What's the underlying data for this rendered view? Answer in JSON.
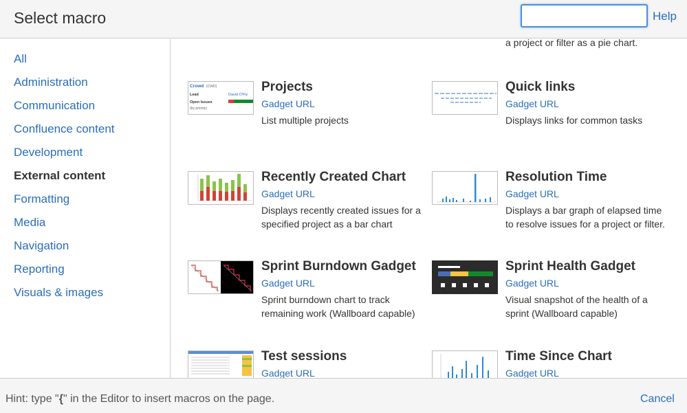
{
  "header": {
    "title": "Select macro",
    "search_value": "",
    "help_label": "Help"
  },
  "sidebar": {
    "categories": [
      {
        "label": "All"
      },
      {
        "label": "Administration"
      },
      {
        "label": "Communication"
      },
      {
        "label": "Confluence content"
      },
      {
        "label": "Development"
      },
      {
        "label": "External content",
        "active": true
      },
      {
        "label": "Formatting"
      },
      {
        "label": "Media"
      },
      {
        "label": "Navigation"
      },
      {
        "label": "Reporting"
      },
      {
        "label": "Visuals & images"
      }
    ]
  },
  "main": {
    "partial_desc": "a project or filter as a pie chart.",
    "macros": [
      {
        "title": "Projects",
        "link": "Gadget URL",
        "desc": "List multiple projects",
        "thumb": {
          "label": "Crowd",
          "sub": "(CWD)",
          "lead": "Lead",
          "lead_name": "David O'Fly",
          "open": "Open Issues",
          "by": "(by priority)"
        }
      },
      {
        "title": "Quick links",
        "link": "Gadget URL",
        "desc": "Displays links for common tasks"
      },
      {
        "title": "Recently Created Chart",
        "link": "Gadget URL",
        "desc": "Displays recently created issues for a specified project as a bar chart"
      },
      {
        "title": "Resolution Time",
        "link": "Gadget URL",
        "desc": "Displays a bar graph of elapsed time to resolve issues for a project or filter."
      },
      {
        "title": "Sprint Burndown Gadget",
        "link": "Gadget URL",
        "desc": "Sprint burndown chart to track remaining work (Wallboard capable)"
      },
      {
        "title": "Sprint Health Gadget",
        "link": "Gadget URL",
        "desc": "Visual snapshot of the health of a sprint (Wallboard capable)"
      },
      {
        "title": "Test sessions",
        "link": "Gadget URL",
        "desc": ""
      },
      {
        "title": "Time Since Chart",
        "link": "Gadget URL",
        "desc": ""
      }
    ]
  },
  "footer": {
    "hint_prefix": "Hint: type \"",
    "hint_char": "{",
    "hint_suffix": "\" in the Editor to insert macros on the page.",
    "cancel_label": "Cancel"
  },
  "colors": {
    "link": "#2a6ebb",
    "accent_focus": "#4a90d9",
    "panel_bg": "#f5f5f5"
  }
}
